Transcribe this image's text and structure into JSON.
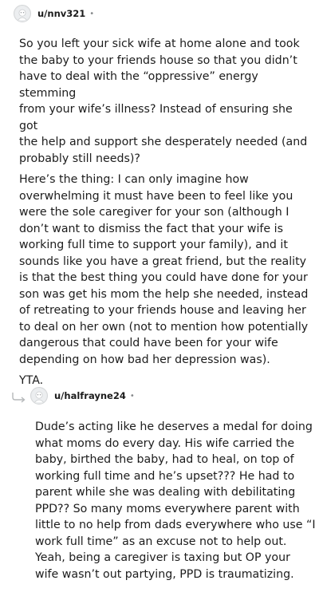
{
  "comment_1": {
    "author": "u/nnv321",
    "separator": "•",
    "paragraphs": [
      "So you left your sick wife at home alone and took\nthe baby to your friends house so that you didn’t\nhave to deal with the “oppressive” energy stemming\nfrom your wife’s illness? Instead of ensuring she got\nthe help and support she desperately needed (and\nprobably still needs)?",
      "Here’s the thing: I can only imagine how\noverwhelming it must have been to feel like you\nwere the sole caregiver for your son (although I\ndon’t want to dismiss the fact that your wife is\nworking full time to support your family), and it\nsounds like you have a great friend, but the reality\nis that the best thing you could have done for your\nson was get his mom the help she needed, instead\nof retreating to your friends house and leaving her\nto deal on her own (not to mention how potentially\ndangerous that could have been for your wife\ndepending on how bad her depression was).",
      "YTA."
    ]
  },
  "comment_2": {
    "author": "u/halfrayne24",
    "separator": "•",
    "paragraphs": [
      "Dude’s acting like he deserves a medal for doing\nwhat moms do every day. His wife carried the\nbaby, birthed the baby, had to heal, on top of\nworking full time and he’s upset??? He had to\nparent while she was dealing with debilitating\nPPD?? So many moms everywhere parent with\nlittle to no help from dads everywhere who use “I\nwork full time” as an excuse not to help out.\nYeah, being a caregiver is taxing but OP your\nwife wasn’t out partying, PPD is traumatizing."
    ]
  },
  "icons": {
    "avatar": "default-avatar-icon",
    "reply": "reply-arrow-icon"
  }
}
